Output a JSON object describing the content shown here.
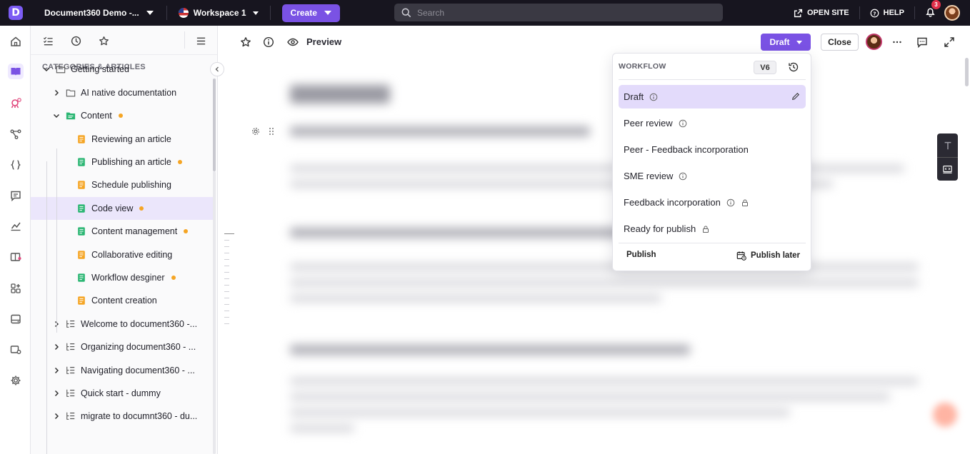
{
  "topbar": {
    "project_name": "Document360 Demo -...",
    "workspace": "Workspace 1",
    "create_label": "Create",
    "search_placeholder": "Search",
    "open_site_label": "OPEN SITE",
    "help_label": "HELP",
    "notification_count": "3"
  },
  "tree": {
    "heading": "CATEGORIES & ARTICLES",
    "nodes": [
      {
        "label": "Getting started",
        "type": "folder",
        "expanded": true
      },
      {
        "label": "AI native documentation",
        "type": "folder",
        "expanded": false
      },
      {
        "label": "Content",
        "type": "folder-green",
        "expanded": true,
        "dot": true
      },
      {
        "label": "Reviewing an article",
        "type": "article-yellow"
      },
      {
        "label": "Publishing an article",
        "type": "article-green",
        "dot": true
      },
      {
        "label": "Schedule publishing",
        "type": "article-yellow"
      },
      {
        "label": "Code view",
        "type": "article-green",
        "dot": true,
        "selected": true
      },
      {
        "label": "Content management",
        "type": "article-green",
        "dot": true
      },
      {
        "label": "Collaborative editing",
        "type": "article-yellow"
      },
      {
        "label": "Workflow desginer",
        "type": "article-green",
        "dot": true
      },
      {
        "label": "Content creation",
        "type": "article-yellow"
      },
      {
        "label": "Welcome to document360 -...",
        "type": "category"
      },
      {
        "label": "Organizing document360 - ...",
        "type": "category"
      },
      {
        "label": "Navigating document360 - ...",
        "type": "category"
      },
      {
        "label": "Quick start - dummy",
        "type": "category"
      },
      {
        "label": "migrate to documnt360 - du...",
        "type": "category"
      }
    ]
  },
  "editor": {
    "preview_label": "Preview",
    "status_button": "Draft",
    "close_label": "Close"
  },
  "workflow": {
    "heading": "WORKFLOW",
    "version": "V6",
    "items": [
      {
        "label": "Draft",
        "info": true,
        "lock": false,
        "active": true
      },
      {
        "label": "Peer review",
        "info": true,
        "lock": false
      },
      {
        "label": "Peer - Feedback incorporation",
        "info": false,
        "lock": false
      },
      {
        "label": "SME review",
        "info": true,
        "lock": false
      },
      {
        "label": "Feedback incorporation",
        "info": true,
        "lock": true
      },
      {
        "label": "Ready for publish",
        "info": false,
        "lock": true
      }
    ],
    "publish_label": "Publish",
    "publish_later_label": "Publish later"
  },
  "colors": {
    "brand": "#7a52e4",
    "topbar_bg": "#17151f",
    "selection": "#ebe6fb",
    "dot_orange": "#f5a524",
    "article_green": "#2bb673",
    "article_yellow": "#f5a524"
  }
}
